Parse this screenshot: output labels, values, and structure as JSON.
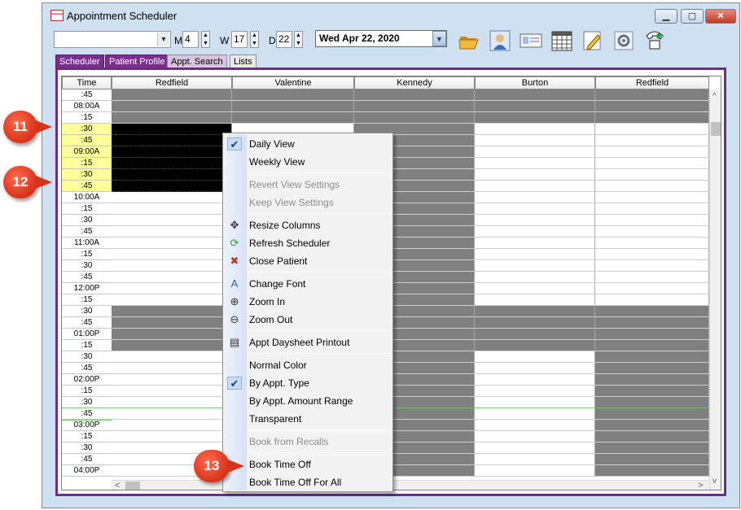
{
  "window": {
    "title": "Appointment Scheduler",
    "controls": [
      "minimize",
      "maximize",
      "close"
    ]
  },
  "toolbar": {
    "provider_combo_value": "",
    "m_label": "M",
    "m_value": "4",
    "w_label": "W",
    "w_value": "17",
    "d_label": "D",
    "d_value": "22",
    "date_value": "Wed  Apr 22, 2020",
    "icons": [
      "open-folder-icon",
      "patient-icon",
      "id-card-icon",
      "calendar-icon",
      "edit-pencil-icon",
      "settings-gear-icon",
      "phone-icon"
    ]
  },
  "tabs": [
    "Scheduler",
    "Patient Profile",
    "Appt. Search",
    "Lists"
  ],
  "grid": {
    "time_header": "Time",
    "columns": [
      "Redfield",
      "Valentine",
      "Kennedy",
      "Burton",
      "Redfield"
    ],
    "times": [
      ":45",
      "08:00A",
      ":15",
      ":30",
      ":45",
      "09:00A",
      ":15",
      ":30",
      ":45",
      "10:00A",
      ":15",
      ":30",
      ":45",
      "11:00A",
      ":15",
      ":30",
      ":45",
      "12:00P",
      ":15",
      ":30",
      ":45",
      "01:00P",
      ":15",
      ":30",
      ":45",
      "02:00P",
      ":15",
      ":30",
      ":45",
      "03:00P",
      ":15",
      ":30",
      ":45",
      "04:00P"
    ],
    "highlighted_rows": [
      3,
      4,
      5,
      6,
      7,
      8
    ],
    "colors": {
      "blocked": "#808080",
      "booked": "#000000",
      "free": "#ffffff",
      "highlight": "#ffff99",
      "accent": "#7a2f8e"
    }
  },
  "context_menu": {
    "items": [
      {
        "label": "Daily View",
        "checked": true,
        "enabled": true
      },
      {
        "label": "Weekly View",
        "enabled": true
      },
      {
        "sep": true
      },
      {
        "label": "Revert View Settings",
        "enabled": false
      },
      {
        "label": "Keep View Settings",
        "enabled": false
      },
      {
        "sep": true
      },
      {
        "label": "Resize Columns",
        "icon": "resize-arrows-icon",
        "enabled": true
      },
      {
        "label": "Refresh Scheduler",
        "icon": "refresh-icon",
        "enabled": true
      },
      {
        "label": "Close Patient",
        "icon": "close-patient-icon",
        "enabled": true
      },
      {
        "sep": true
      },
      {
        "label": "Change Font",
        "icon": "font-icon",
        "enabled": true
      },
      {
        "label": "Zoom In",
        "icon": "zoom-in-icon",
        "enabled": true
      },
      {
        "label": "Zoom Out",
        "icon": "zoom-out-icon",
        "enabled": true
      },
      {
        "sep": true
      },
      {
        "label": "Appt Daysheet Printout",
        "icon": "document-icon",
        "enabled": true
      },
      {
        "sep": true
      },
      {
        "label": "Normal Color",
        "enabled": true
      },
      {
        "label": "By Appt. Type",
        "checked": true,
        "enabled": true
      },
      {
        "label": "By Appt. Amount Range",
        "enabled": true
      },
      {
        "label": "Transparent",
        "enabled": true
      },
      {
        "sep": true
      },
      {
        "label": "Book from Recalls",
        "enabled": false
      },
      {
        "sep": true
      },
      {
        "label": "Book Time Off",
        "enabled": true
      },
      {
        "label": "Book Time Off For All",
        "enabled": true
      }
    ]
  },
  "callouts": [
    "11",
    "12",
    "13"
  ]
}
